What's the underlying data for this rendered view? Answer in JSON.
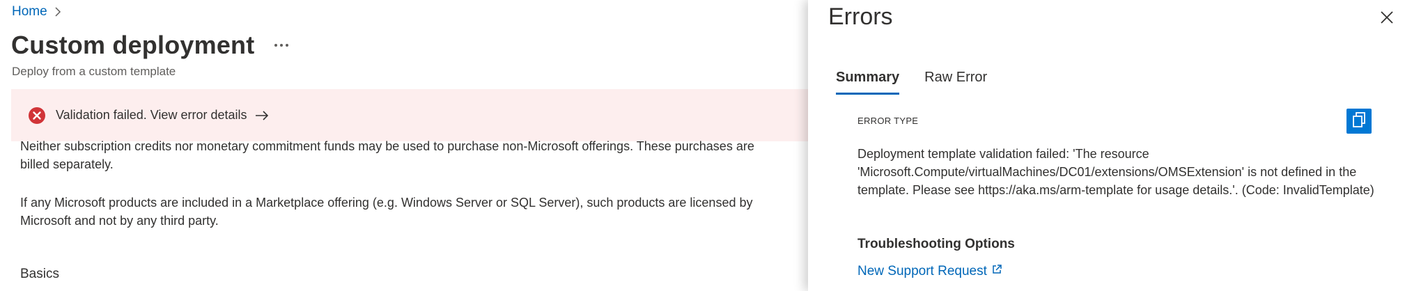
{
  "breadcrumb": {
    "home": "Home"
  },
  "page": {
    "title": "Custom deployment",
    "more": "···",
    "subtitle": "Deploy from a custom template"
  },
  "banner": {
    "message": "Validation failed. View error details",
    "color": "#d13438",
    "background": "#fdeeee"
  },
  "content": {
    "para1": "Neither subscription credits nor monetary commitment funds may be used to purchase non-Microsoft offerings. These purchases are billed separately.",
    "para2": "If any Microsoft products are included in a Marketplace offering (e.g. Windows Server or SQL Server), such products are licensed by Microsoft and not by any third party.",
    "section": "Basics"
  },
  "panel": {
    "title": "Errors",
    "tabs": [
      {
        "label": "Summary",
        "active": true
      },
      {
        "label": "Raw Error",
        "active": false
      }
    ],
    "error_type_label": "ERROR TYPE",
    "error_text": "Deployment template validation failed: 'The resource 'Microsoft.Compute/virtualMachines/DC01/extensions/OMSExtension' is not defined in the template. Please see https://aka.ms/arm-template for usage details.'. (Code: InvalidTemplate)",
    "troubleshooting_title": "Troubleshooting Options",
    "support_link": "New Support Request"
  },
  "icons": {
    "chevron": "chevron-right-icon",
    "error": "error-circle-icon",
    "arrow": "arrow-right-icon",
    "close": "close-icon",
    "copy": "copy-icon",
    "external": "external-link-icon"
  },
  "colors": {
    "accent": "#0078d4",
    "link": "#0067b8"
  }
}
